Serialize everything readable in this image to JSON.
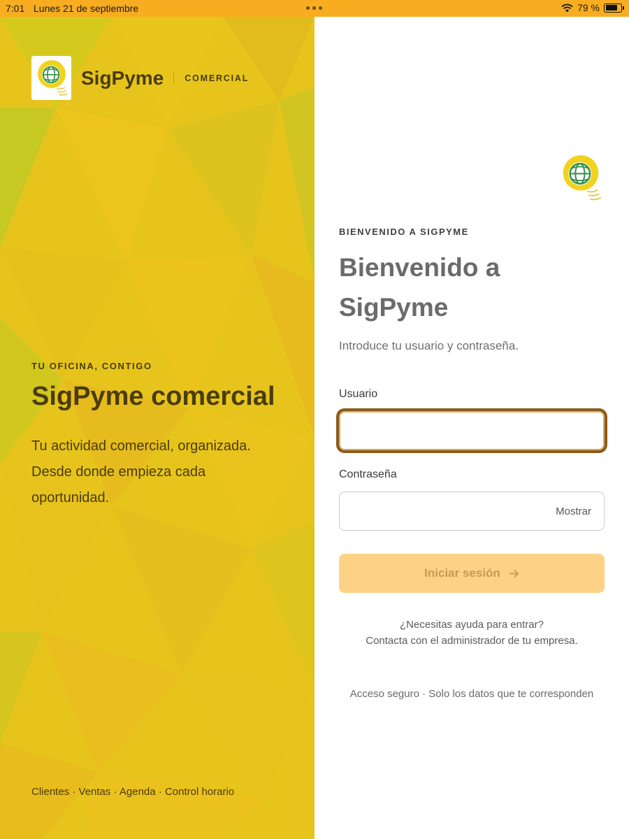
{
  "status_bar": {
    "time": "7:01",
    "date": "Lunes 21 de septiembre",
    "battery": "79 %",
    "icons": [
      "multitask-dots-icon",
      "wifi-icon",
      "battery-icon"
    ]
  },
  "brand": {
    "name": "SigPyme",
    "subtitle": "COMERCIAL",
    "logo_icon": "globe-lightbulb-logo"
  },
  "hero": {
    "tagline": "TU OFICINA, CONTIGO",
    "title": "SigPyme comercial",
    "description_lines": [
      "Tu actividad comercial, organizada.",
      "Desde donde empieza cada",
      "oportunidad."
    ],
    "footer": "Clientes · Ventas · Agenda · Control horario"
  },
  "login": {
    "eyebrow": "BIENVENIDO A SIGPYME",
    "heading_lines": [
      "Bienvenido a",
      "SigPyme"
    ],
    "intro": "Introduce tu usuario y contraseña.",
    "username_label": "Usuario",
    "username_value": "",
    "password_label": "Contraseña",
    "password_value": "",
    "show_label": "Mostrar",
    "submit_label": "Iniciar sesión",
    "submit_icon": "arrow-right-icon",
    "help_lines": [
      "¿Necesitas ayuda para entrar?",
      "Contacta con el administrador de tu empresa."
    ],
    "secure_note": "Acceso seguro · Solo los datos que te corresponden"
  },
  "colors": {
    "status_bar": "#f7ad1f",
    "left_panel": "#e6c41c",
    "text_dark": "#4a3c0c",
    "focus_ring": "#8c5b1b",
    "button_disabled": "#fdd287"
  }
}
